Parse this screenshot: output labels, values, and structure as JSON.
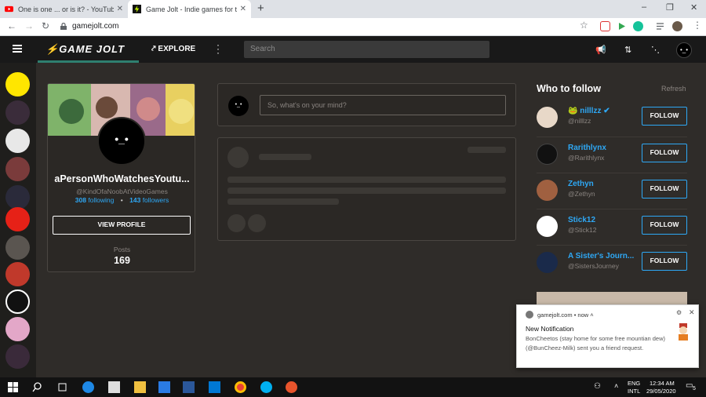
{
  "browser": {
    "tabs": [
      {
        "title": "One is one ... or is it? - YouTube",
        "close": "✕"
      },
      {
        "title": "Game Jolt - Indie games for the lo",
        "close": "✕"
      }
    ],
    "new_tab": "+",
    "url": "gamejolt.com",
    "window_controls": [
      "–",
      "❐",
      "✕"
    ]
  },
  "nav": {
    "logo": "GAME JOLT",
    "explore": "EXPLORE",
    "search_placeholder": "Search",
    "avatar_face": "•_•"
  },
  "profile": {
    "display_name": "aPersonWhoWatchesYoutu...",
    "handle": "@KindOfaNoobAtVideoGames",
    "following_count": "308",
    "following_label": "following",
    "followers_count": "143",
    "followers_label": "followers",
    "view_profile": "VIEW PROFILE",
    "posts_label": "Posts",
    "posts_count": "169",
    "avatar_face": "•_•"
  },
  "composer": {
    "placeholder": "So, what's on your mind?",
    "avatar_face": "•_•"
  },
  "who_to_follow": {
    "title": "Who to follow",
    "refresh": "Refresh",
    "follow_label": "FOLLOW",
    "users": [
      {
        "name": "nilllzz",
        "handle": "@nilllzz"
      },
      {
        "name": "Rarithlynx",
        "handle": "@Rarithlynx"
      },
      {
        "name": "Zethyn",
        "handle": "@Zethyn"
      },
      {
        "name": "Stick12",
        "handle": "@Stick12"
      },
      {
        "name": "A Sister's Journ...",
        "handle": "@SistersJourney"
      }
    ]
  },
  "notification": {
    "source": "gamejolt.com",
    "time": "now",
    "title": "New Notification",
    "message": "BonCheetos (stay home for some free mountian dew) (@BunCheez-Milk) sent you a friend request."
  },
  "taskbar": {
    "lang_top": "ENG",
    "lang_bottom": "INTL",
    "time": "12:34 AM",
    "date": "29/05/2020",
    "notif_count": "5"
  },
  "colors": {
    "accent_blue": "#2ea8f5",
    "bg": "#2f2c29",
    "nav_bg": "#191919"
  }
}
